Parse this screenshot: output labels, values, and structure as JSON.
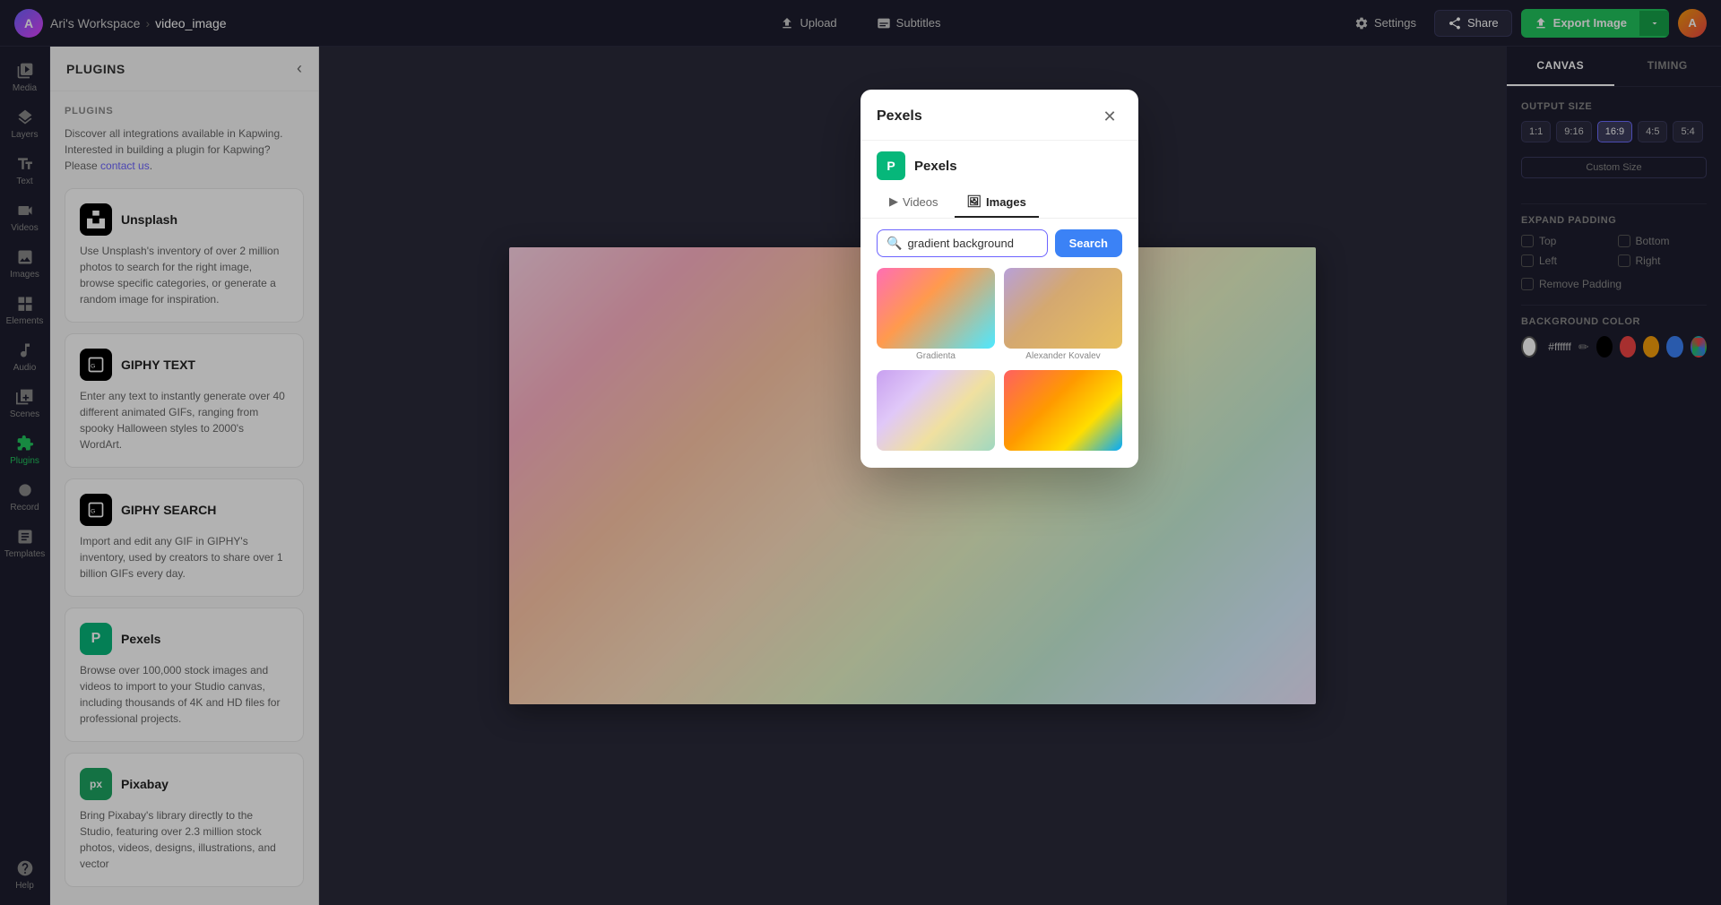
{
  "app": {
    "workspace": "Ari's Workspace",
    "project": "video_image"
  },
  "topbar": {
    "upload_label": "Upload",
    "subtitles_label": "Subtitles",
    "settings_label": "Settings",
    "share_label": "Share",
    "export_label": "Export Image"
  },
  "sidebar": {
    "items": [
      {
        "id": "media",
        "label": "Media"
      },
      {
        "id": "layers",
        "label": "Layers"
      },
      {
        "id": "text",
        "label": "Text"
      },
      {
        "id": "videos",
        "label": "Videos"
      },
      {
        "id": "images",
        "label": "Images"
      },
      {
        "id": "elements",
        "label": "Elements"
      },
      {
        "id": "audio",
        "label": "Audio"
      },
      {
        "id": "scenes",
        "label": "Scenes"
      },
      {
        "id": "plugins",
        "label": "Plugins"
      },
      {
        "id": "record",
        "label": "Record"
      },
      {
        "id": "templates",
        "label": "Templates"
      }
    ],
    "bottom_item": "Help"
  },
  "plugins_panel": {
    "title": "PLUGINS",
    "section_title": "PLUGINS",
    "intro": "Discover all integrations available in Kapwing. Interested in building a plugin for Kapwing? Please",
    "contact_link": "contact us",
    "plugins": [
      {
        "id": "unsplash",
        "name": "Unsplash",
        "desc": "Use Unsplash's inventory of over 2 million photos to search for the right image, browse specific categories, or generate a random image for inspiration."
      },
      {
        "id": "giphy-text",
        "name": "GIPHY TEXT",
        "desc": "Enter any text to instantly generate over 40 different animated GIFs, ranging from spooky Halloween styles to 2000's WordArt."
      },
      {
        "id": "giphy-search",
        "name": "GIPHY SEARCH",
        "desc": "Import and edit any GIF in GIPHY's inventory, used by creators to share over 1 billion GIFs every day."
      },
      {
        "id": "pexels",
        "name": "Pexels",
        "desc": "Browse over 100,000 stock images and videos to import to your Studio canvas, including thousands of 4K and HD files for professional projects."
      },
      {
        "id": "pixabay",
        "name": "Pixabay",
        "desc": "Bring Pixabay's library directly to the Studio, featuring over 2.3 million stock photos, videos, designs, illustrations, and vector"
      }
    ]
  },
  "right_panel": {
    "tabs": [
      {
        "id": "canvas",
        "label": "CANVAS"
      },
      {
        "id": "timing",
        "label": "TIMING"
      }
    ],
    "output_size": {
      "label": "OUTPUT SIZE",
      "sizes": [
        "1:1",
        "9:16",
        "16:9",
        "4:5",
        "5:4"
      ],
      "active": "16:9",
      "custom_label": "Custom Size"
    },
    "expand_padding": {
      "label": "EXPAND PADDING",
      "options": [
        "Top",
        "Bottom",
        "Left",
        "Right"
      ],
      "remove_label": "Remove Padding"
    },
    "background_color": {
      "label": "BACKGROUND COLOR",
      "hex": "#ffffff",
      "swatches": [
        "white",
        "black",
        "red",
        "yellow",
        "blue",
        "gradient"
      ]
    }
  },
  "pexels_modal": {
    "title": "Pexels",
    "brand_name": "Pexels",
    "brand_icon": "P",
    "tabs": [
      {
        "id": "videos",
        "label": "Videos",
        "icon": "▶"
      },
      {
        "id": "images",
        "label": "Images",
        "icon": "🖼"
      }
    ],
    "active_tab": "images",
    "search": {
      "value": "gradient background",
      "placeholder": "gradient background",
      "button_label": "Search"
    },
    "results": [
      {
        "id": 1,
        "label": "Gradienta"
      },
      {
        "id": 2,
        "label": "Alexander Kovalev"
      },
      {
        "id": 3,
        "label": ""
      },
      {
        "id": 4,
        "label": ""
      }
    ]
  }
}
